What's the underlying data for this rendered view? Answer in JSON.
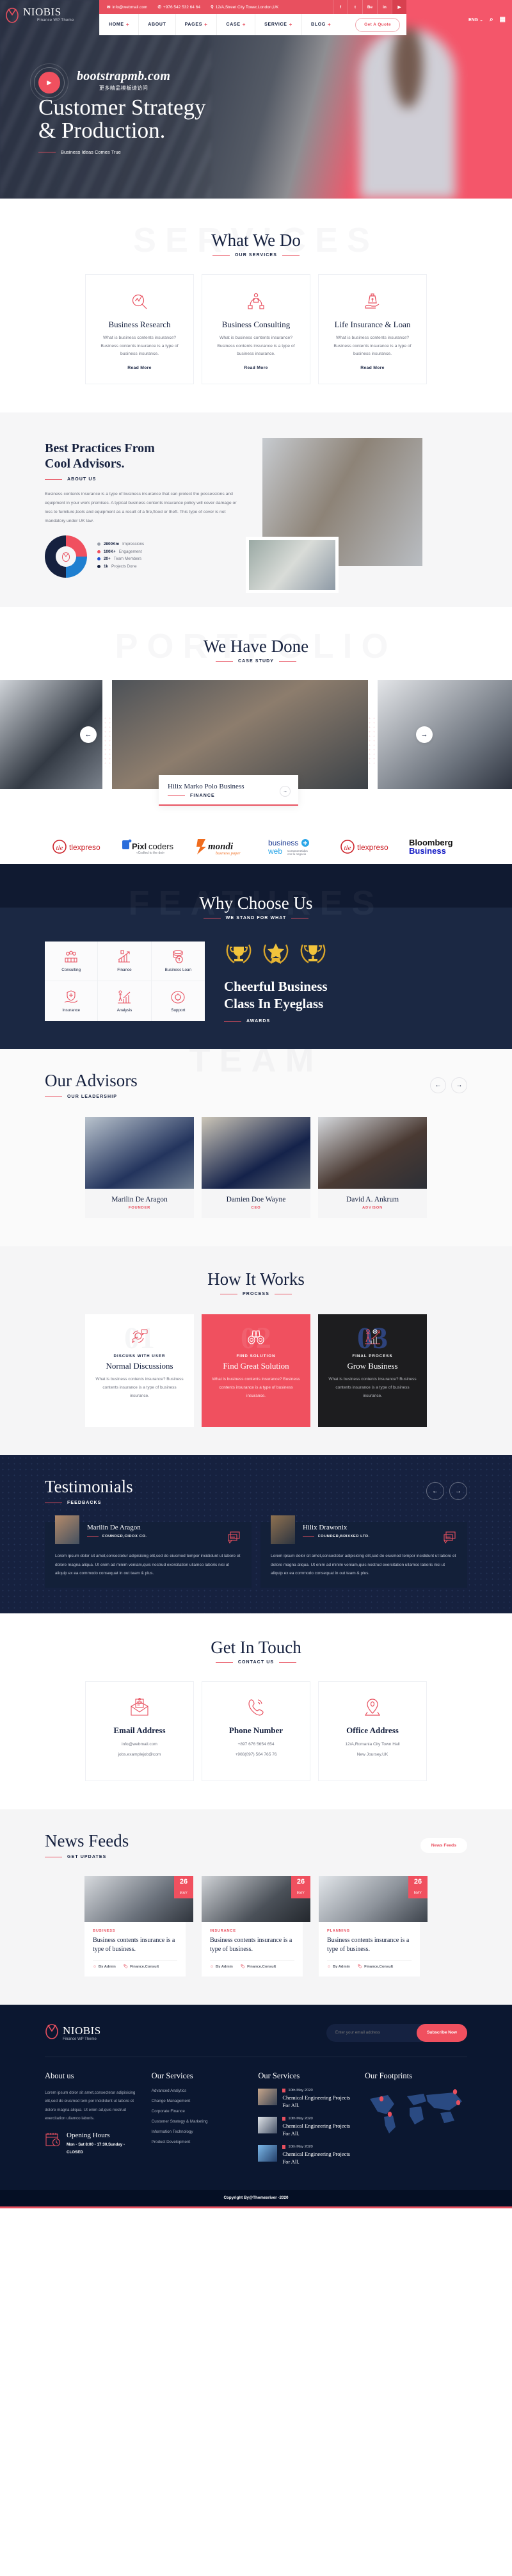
{
  "topbar": {
    "email": "info@webmail.com",
    "phone": "+976 542 532 64 64",
    "address": "12/A,Street City Tower,London,UK",
    "social": [
      "f",
      "t",
      "be",
      "in",
      "yt"
    ]
  },
  "brand": {
    "name": "NIOBIS",
    "tagline": "Finance WP Theme"
  },
  "nav": {
    "items": [
      "HOME",
      "ABOUT",
      "PAGES",
      "CASE",
      "SERVICE",
      "BLOG"
    ],
    "quote_label": "Get A Quote",
    "lang": "ENG",
    "search_icon": "search-icon",
    "grid_icon": "grid-icon"
  },
  "hero": {
    "watermark_title": "bootstrapmb.com",
    "watermark_sub": "更多精品模板请访问",
    "heading_line1": "Customer Strategy",
    "heading_line2": "& Production.",
    "tagline": "Business Ideas Comes True",
    "play_icon": "play-icon"
  },
  "services": {
    "ghost": "SERVICES",
    "title": "What We Do",
    "sub": "OUR SERVICES",
    "cards": [
      {
        "icon": "research-magnifier-icon",
        "title": "Business Research",
        "desc": "What is business contents insurance? Business contents insurance is a type of business insurance.",
        "more": "Read More"
      },
      {
        "icon": "consulting-network-icon",
        "title": "Business Consulting",
        "desc": "What is business contents insurance? Business contents insurance is a type of business insurance.",
        "more": "Read More"
      },
      {
        "icon": "insurance-hand-icon",
        "title": "Life Insurance & Loan",
        "desc": "What is business contents insurance? Business contents insurance is a type of business insurance.",
        "more": "Read More"
      }
    ]
  },
  "about": {
    "heading_line1": "Best Practices From",
    "heading_line2": "Cool Advisors.",
    "sub": "ABOUT US",
    "paragraph": "Business contents insurance is a type of business insurance that can protect the possessions and equipment in your work premises. A typical business contents insurance policy will cover damage or loss to furniture,tools and equipment as a result of a fire,flood or theft. This type of cover is not mandatory under UK law.",
    "chart_data": {
      "type": "pie",
      "title": "",
      "categories": [
        "2800Km Impressions",
        "100K+ Engagement",
        "20+ Team Members",
        "1k Projects Done"
      ],
      "values": [
        25,
        25,
        25,
        25
      ],
      "colors": [
        "#9aa0ab",
        "#f0505f",
        "#1f7fd0",
        "#16213f"
      ],
      "legend": [
        {
          "value": "2800Km",
          "label": "Impressions",
          "color": "#9aa0ab"
        },
        {
          "value": "100K+",
          "label": "Engagement",
          "color": "#f0505f"
        },
        {
          "value": "20+",
          "label": "Team Members",
          "color": "#1f4fd0"
        },
        {
          "value": "1k",
          "label": "Projects Done",
          "color": "#16213f"
        }
      ]
    }
  },
  "portfolio": {
    "ghost": "PORTFOLIO",
    "title": "We Have Done",
    "sub": "CASE STUDY",
    "card_title": "Hilix Marko Polo Business",
    "card_tag": "FINANCE",
    "prev_icon": "arrow-left-icon",
    "next_icon": "arrow-right-icon"
  },
  "brands": [
    {
      "name": "tlexpreso"
    },
    {
      "name": "Pixlcoders",
      "sub": "«Crafted to the dot»"
    },
    {
      "name": "mondi",
      "sub": "business paper"
    },
    {
      "name": "business web",
      "sub": "Comprometidos con tu negocio"
    },
    {
      "name": "tlexpreso"
    },
    {
      "name": "Bloomberg Business"
    }
  ],
  "features": {
    "ghost": "FEATURES",
    "title": "Why Choose Us",
    "sub": "WE STAND FOR WHAT",
    "cells": [
      {
        "icon": "team-consulting-icon",
        "label": "Consulting"
      },
      {
        "icon": "growth-chart-icon",
        "label": "Finance"
      },
      {
        "icon": "coins-dollar-icon",
        "label": "Business Loan"
      },
      {
        "icon": "insurance-shield-hand-icon",
        "label": "Insurance"
      },
      {
        "icon": "analysis-bar-icon",
        "label": "Analysis"
      },
      {
        "icon": "support-gear-icon",
        "label": "Support"
      }
    ],
    "awards_icons": [
      "trophy-laurel-icon",
      "star-laurel-icon",
      "cup-laurel-icon"
    ],
    "heading_line1": "Cheerful Business",
    "heading_line2": "Class In Eyeglass",
    "awards_label": "AWARDS"
  },
  "team": {
    "ghost": "TEAM",
    "title": "Our Advisors",
    "sub": "OUR LEADERSHIP",
    "prev_icon": "arrow-left-icon",
    "next_icon": "arrow-right-icon",
    "members": [
      {
        "name": "Marilin De Aragon",
        "role": "FOUNDER"
      },
      {
        "name": "Damien Doe Wayne",
        "role": "CEO"
      },
      {
        "name": "David A. Ankrum",
        "role": "ADVISON"
      }
    ]
  },
  "process": {
    "title": "How It Works",
    "sub": "PROCESS",
    "steps": [
      {
        "num": "01",
        "icon": "discussion-headset-icon",
        "kicker": "DISCUSS WITH USER",
        "title": "Normal Discussions",
        "desc": "What is business contents insurance? Business contents insurance is a type of business insurance."
      },
      {
        "num": "02",
        "icon": "binoculars-icon",
        "kicker": "FIND SOLUTION",
        "title": "Find Great Solution",
        "desc": "What is business contents insurance? Business contents insurance is a type of business insurance."
      },
      {
        "num": "03",
        "icon": "growth-person-icon",
        "kicker": "FINAL PROCESS",
        "title": "Grow Business",
        "desc": "What is business contents insurance? Business contents insurance is a type of business insurance."
      }
    ]
  },
  "testimonials": {
    "title": "Testimonials",
    "sub": "FEEDBACKS",
    "prev_icon": "arrow-left-icon",
    "next_icon": "arrow-right-icon",
    "items": [
      {
        "name": "Marilin De Aragon",
        "role": "FOUNDER,CIDOX CO.",
        "quote": "Lorem ipsum dolor sit amet,consectetur adipisicing elit,sed do eiusmod tempor incididunt ut labore et dolore magna aliqua. Ut enim ad minim veniam,quis nostrud exercitation ullamco laboris nisi ut aliquip ex ea commodo consequat in out team & plus."
      },
      {
        "name": "Hilix Drawonix",
        "role": "FOUNDER,BRIXXER LTD.",
        "quote": "Lorem ipsum dolor sit amet,consectetur adipisicing elit,sed do eiusmod tempor incididunt ut labore et dolore magna aliqua. Ut enim ad minim veniam,quis nostrud exercitation ullamco laboris nisi ut aliquip ex ea commodo consequat in out team & plus."
      }
    ]
  },
  "contact": {
    "title": "Get In Touch",
    "sub": "CONTACT US",
    "cards": [
      {
        "icon": "envelope-open-icon",
        "title": "Email Address",
        "line1": "info@webmail.com",
        "line2": "jobs.examplejob@com"
      },
      {
        "icon": "phone-ring-icon",
        "title": "Phone Number",
        "line1": "+897 676 5654 654",
        "line2": "+908(097) 564 765 76"
      },
      {
        "icon": "map-pin-icon",
        "title": "Office Address",
        "line1": "12/A,Romania City Town Hall",
        "line2": "New Joursey,UK"
      }
    ]
  },
  "news": {
    "title": "News Feeds",
    "sub": "GET UPDATES",
    "button": "News Feeds",
    "posts": [
      {
        "day": "26",
        "month": "MAY",
        "cat": "BUSINESS",
        "title": "Business contents insurance is a type of business.",
        "author": "By Admin",
        "tags": "Finance,Consult"
      },
      {
        "day": "26",
        "month": "MAY",
        "cat": "INSURANCE",
        "title": "Business contents insurance is a type of business.",
        "author": "By Admin",
        "tags": "Finance,Consult"
      },
      {
        "day": "26",
        "month": "MAY",
        "cat": "PLANNING",
        "title": "Business contents insurance is a type of business.",
        "author": "By Admin",
        "tags": "Finance,Consult"
      }
    ]
  },
  "footer": {
    "newsletter_placeholder": "Enter your email address",
    "subscribe_label": "Subscribe Now",
    "about": {
      "title": "About us",
      "text": "Lorem ipsum dolor sit amet,consectetur adipisicing elit,sed do eiusmod tem por incididunt ut labore et dolore magna aliqua. Ut enim ad,quis nostrud exercitation ullamco laboris.",
      "hours_icon": "calendar-clock-icon",
      "hours_title": "Opening Hours",
      "hours_text": "Mon - Sat 8:00 - 17:30,Sunday - CLOSED"
    },
    "services": {
      "title": "Our Services",
      "items": [
        "Advanced Analytics",
        "Change Management",
        "Corporate Finance",
        "Customer Strategy & Marketing",
        "Information Technology",
        "Product Development"
      ]
    },
    "posts": {
      "title": "Our Services",
      "items": [
        {
          "date": "10th May 2020",
          "title": "Chemical Engineering Projects For All."
        },
        {
          "date": "10th May 2020",
          "title": "Chemical Engineering Projects For All."
        },
        {
          "date": "10th May 2020",
          "title": "Chemical Engineering Projects For All."
        }
      ]
    },
    "footprints": {
      "title": "Our Footprints"
    },
    "copyright": "Copyright By@Themexriver -2020"
  }
}
